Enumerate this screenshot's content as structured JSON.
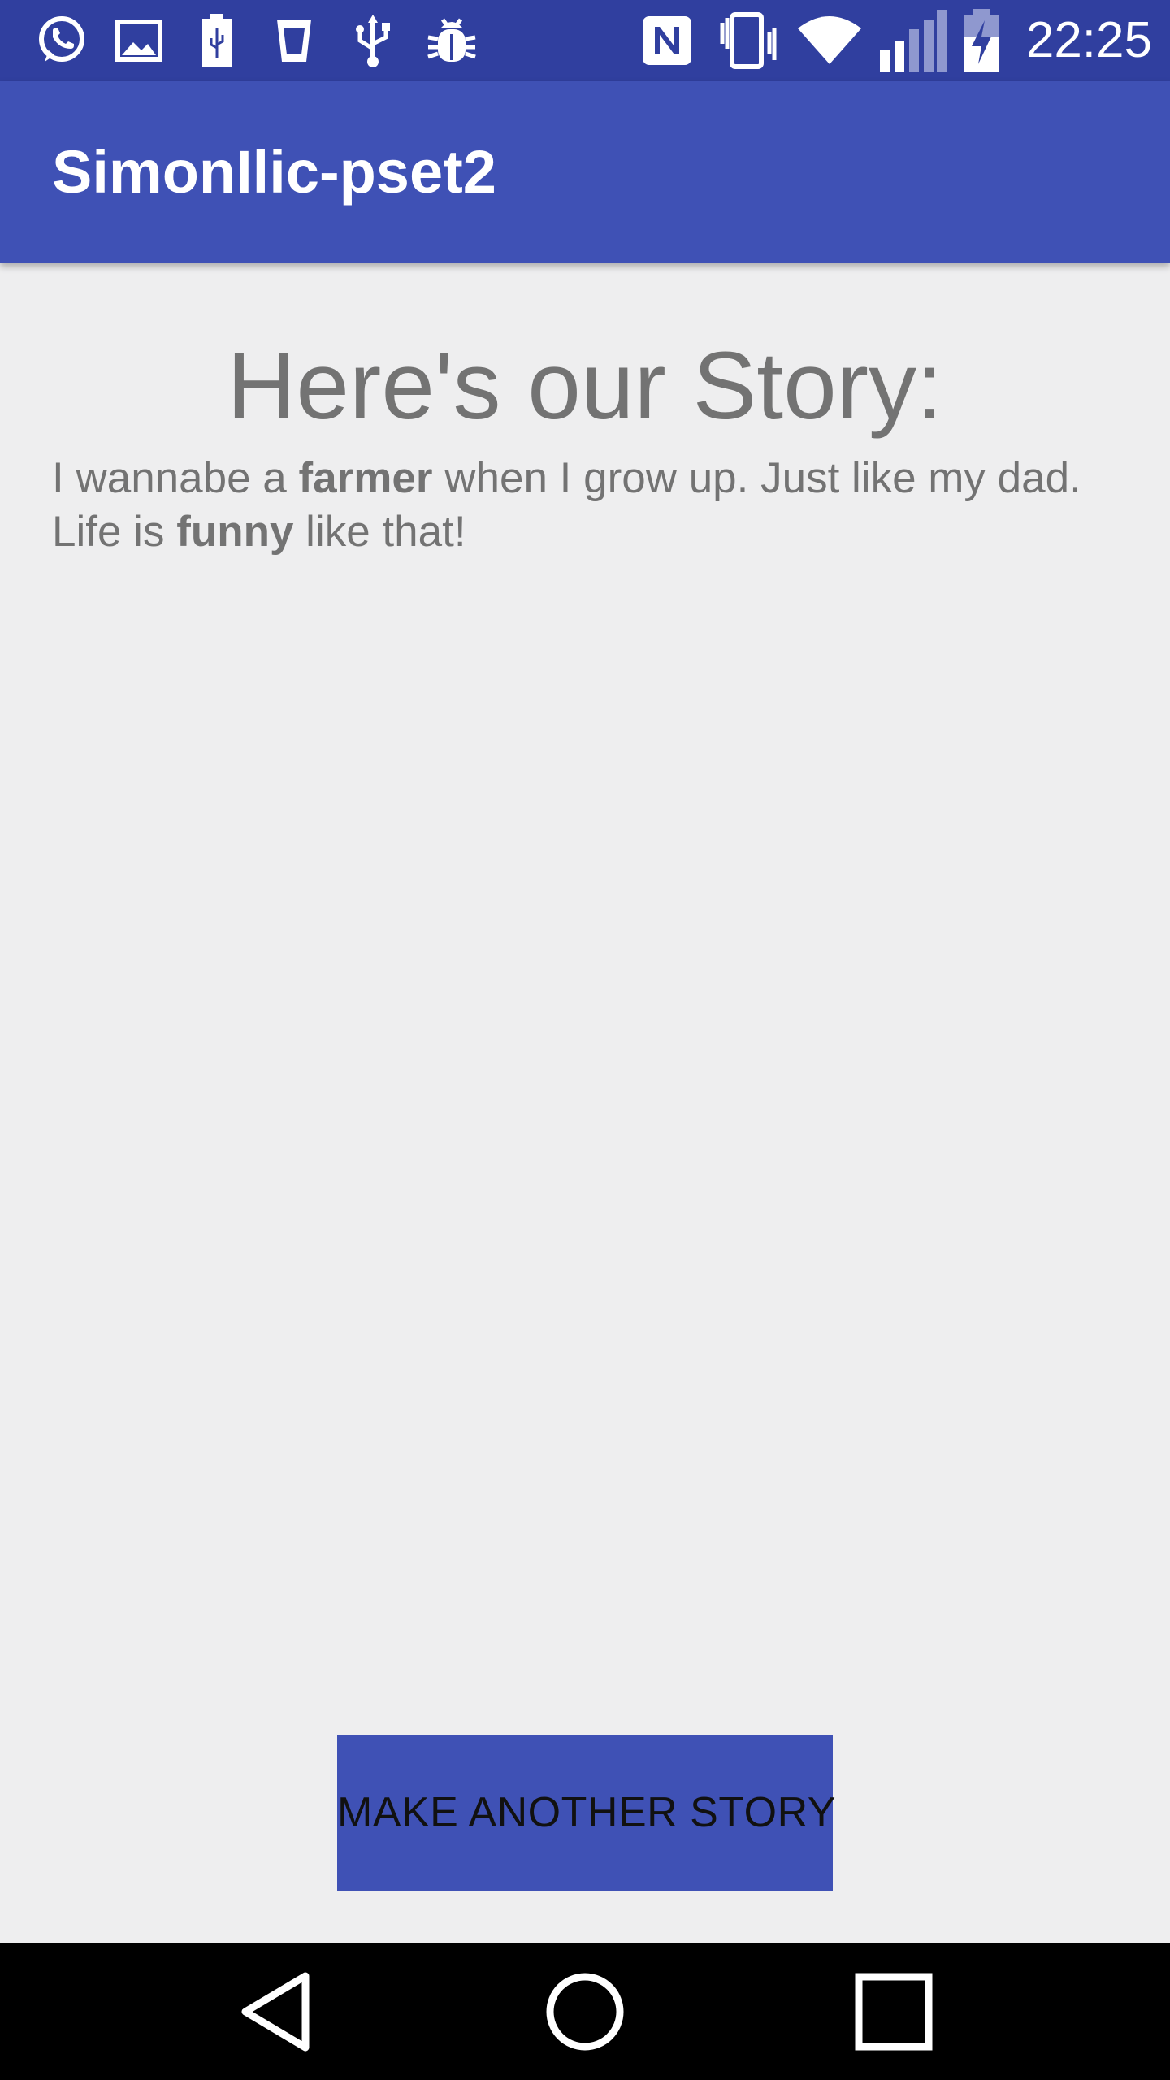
{
  "status_bar": {
    "time": "22:25",
    "icons": [
      "whatsapp-icon",
      "gallery-icon",
      "battery-saver-icon",
      "cup-icon",
      "usb-icon",
      "bug-icon",
      "nfc-icon",
      "vibrate-icon",
      "wifi-icon",
      "signal-icon",
      "battery-charging-icon"
    ]
  },
  "app_bar": {
    "title": "SimonIlic-pset2"
  },
  "main": {
    "heading": "Here's our Story:",
    "story": {
      "part1": "I wannabe a ",
      "word1": "farmer",
      "part2": " when I grow up. Just like my dad. Life is ",
      "word2": "funny",
      "part3": " like that!"
    },
    "button_label": "MAKE ANOTHER STORY"
  },
  "nav_bar": {
    "buttons": [
      "back-icon",
      "home-icon",
      "recents-icon"
    ]
  },
  "colors": {
    "status_bar": "#303f9f",
    "app_bar": "#3f51b5",
    "background": "#eeeeef",
    "text": "#737373",
    "button": "#3f51b5"
  }
}
